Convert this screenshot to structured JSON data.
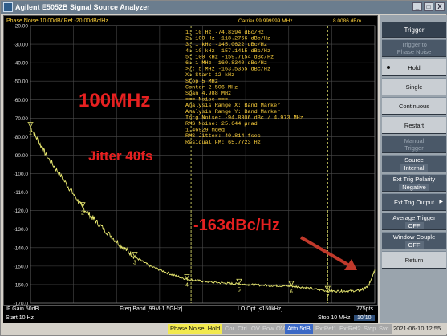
{
  "window": {
    "title": "Agilent E5052B Signal Source Analyzer",
    "controls": [
      "_",
      "□",
      "X"
    ]
  },
  "trace_header": {
    "left": "Phase Noise 10.00dB/ Ref -20.00dBc/Hz",
    "carrier": "Carrier 99.999999 MHz",
    "power": "8.0086 dBm"
  },
  "markers_table": [
    "1:   10 Hz       -74.8394 dBc/Hz",
    "2:   100 Hz     -118.2766 dBc/Hz",
    "3:   1 kHz      -145.0622 dBc/Hz",
    "4:   10 kHz     -157.1415 dBc/Hz",
    "5:   100 kHz    -159.7154 dBc/Hz",
    "6:   1 MHz      -160.8340 dBc/Hz",
    ">7:  5 MHz      -163.5355 dBc/Hz",
    "X: Start 12 kHz",
    "   Stop 5 MHz",
    "   Center 2.506 MHz",
    "   Span 4.988 MHz",
    "=== Noise ===",
    "Analysis Range X: Band Marker",
    "Analysis Range Y: Band Marker",
    "Intg Noise: -94.8306 dBc / 4.973 MHz",
    "RMS Noise: 25.644 µrad",
    "           1.46929 mdeg",
    "RMS Jitter: 40.814 fsec",
    "Residual FM: 65.7723 Hz"
  ],
  "annotations": {
    "freq": "100MHz",
    "jitter": "Jitter 40fs",
    "floor": "-163dBc/Hz"
  },
  "chart_data": {
    "type": "line",
    "x_scale": "log",
    "xlim": [
      10,
      40000000
    ],
    "ylim": [
      -170,
      -20
    ],
    "y_ticks": [
      "-20.00",
      "-30.00",
      "-40.00",
      "-50.00",
      "-60.00",
      "-70.00",
      "-80.00",
      "-90.00",
      "-100.0",
      "-110.0",
      "-120.0",
      "-130.0",
      "-140.0",
      "-150.0",
      "-160.0",
      "-170.0"
    ],
    "series": [
      {
        "x": [
          10,
          20,
          50,
          100,
          200,
          500,
          1000,
          2000,
          5000,
          10000,
          20000,
          50000,
          100000,
          200000,
          500000,
          1000000,
          2000000,
          5000000,
          10000000,
          20000000,
          30000000,
          40000000
        ],
        "y": [
          -74.8,
          -90,
          -106,
          -118.3,
          -127,
          -138,
          -145.1,
          -150,
          -154.5,
          -157.1,
          -158.2,
          -159.2,
          -159.7,
          -160.2,
          -160.6,
          -160.8,
          -161.8,
          -163.5,
          -163.5,
          -163.3,
          -161,
          -152
        ]
      }
    ],
    "markers": [
      {
        "label": "1",
        "x": 10,
        "y": -74.8394
      },
      {
        "label": "2",
        "x": 100,
        "y": -118.2766
      },
      {
        "label": "3",
        "x": 1000,
        "y": -145.0622
      },
      {
        "label": "4",
        "x": 10000,
        "y": -157.1415
      },
      {
        "label": "5",
        "x": 100000,
        "y": -159.7154
      },
      {
        "label": "6",
        "x": 1000000,
        "y": -160.834
      },
      {
        "label": "7",
        "x": 5000000,
        "y": -163.5355
      }
    ],
    "band": {
      "start": 12000,
      "stop": 5000000
    }
  },
  "bottom": {
    "ifgain": "IF Gain 50dB",
    "freqband": "Freq Band [99M-1.5GHz]",
    "loopt": "LO Opt [<150kHz]",
    "points": "775pts",
    "start": "Start 10 Hz",
    "stop": "Stop 10 MHz",
    "count": "10/10"
  },
  "status": {
    "mode": "Phase Noise: Hold",
    "cor": "Cor",
    "ctrl": "Ctrl",
    "ov": "OV",
    "pow": "Pow",
    "ov2": "OV",
    "attn": "Attn 5dB",
    "extref1": "ExtRef1",
    "extref2": "ExtRef2",
    "stop": "Stop",
    "svc": "Svc",
    "datetime": "2021-06-10 12:55"
  },
  "softkeys": {
    "title": "Trigger",
    "trigger_to": "Trigger to\nPhase Noise",
    "hold": "Hold",
    "single": "Single",
    "continuous": "Continuous",
    "restart": "Restart",
    "manual": "Manual\nTrigger",
    "source_label": "Source",
    "source_value": "Internal",
    "polarity_label": "Ext Trig Polarity",
    "polarity_value": "Negative",
    "output_label": "Ext Trig Output",
    "avg_label": "Average Trigger",
    "avg_value": "OFF",
    "couple_label": "Window Couple",
    "couple_value": "OFF",
    "return": "Return"
  },
  "colors": {
    "trace": "#e8e870",
    "text_yellow": "#ffd23c",
    "annotation_red": "#e62020",
    "arrow": "#c0392b",
    "marker_text": "#e8e870"
  }
}
